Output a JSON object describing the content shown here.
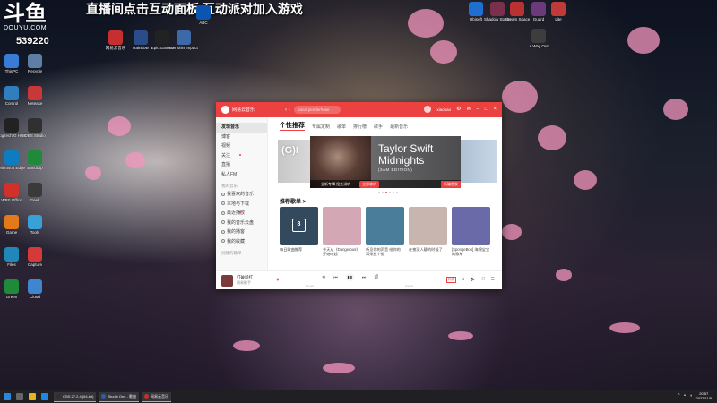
{
  "stream": {
    "logo_text": "斗鱼",
    "logo_sub": "DOUYU.COM",
    "room_number": "539220",
    "banner": "直播间点击互动面板 互动派对加入游戏"
  },
  "desktop_icons": {
    "top_row": [
      {
        "label": "网易云音乐",
        "color": "#c62f2f"
      },
      {
        "label": "Rainbow",
        "color": "#2a4d8a"
      },
      {
        "label": "Epic Games",
        "color": "#222222"
      },
      {
        "label": "Genshin Impact",
        "color": "#3c6aa8"
      },
      {
        "label": "ABC",
        "color": "#0a55b0"
      }
    ],
    "top_right": [
      {
        "label": "Ubisoft",
        "color": "#1f6fd1"
      },
      {
        "label": "Shadow Spirits",
        "color": "#7a2f4a"
      },
      {
        "label": "Stream Space",
        "color": "#b93131"
      },
      {
        "label": "Guard",
        "color": "#6b3a7a"
      },
      {
        "label": "Lite",
        "color": "#c03a3a"
      },
      {
        "label": "A Way Out",
        "color": "#3d3d3d"
      }
    ],
    "left_col": [
      {
        "label": "ThisPC",
        "color": "#3a7bd5"
      },
      {
        "label": "Recycle",
        "color": "#5e7ea6"
      },
      {
        "label": "Control",
        "color": "#2f7fbf"
      },
      {
        "label": "Netease",
        "color": "#c83838"
      },
      {
        "label": "Logitech G HUB",
        "color": "#222222"
      },
      {
        "label": "OBS Studio",
        "color": "#303030"
      },
      {
        "label": "Microsoft Edge",
        "color": "#0f7bc1"
      },
      {
        "label": "Bandizip",
        "color": "#1e8a3a"
      },
      {
        "label": "WPS Office",
        "color": "#d2302b"
      },
      {
        "label": "Geek",
        "color": "#3a3a3a"
      },
      {
        "label": "Game",
        "color": "#e37a1a"
      },
      {
        "label": "Tools",
        "color": "#3aa0d8"
      },
      {
        "label": "Files",
        "color": "#1f88b8"
      },
      {
        "label": "Capture",
        "color": "#d43a3a"
      },
      {
        "label": "Green",
        "color": "#1f8a3a"
      },
      {
        "label": "Cloud",
        "color": "#3f86d0"
      }
    ]
  },
  "window": {
    "app_name": "网易云音乐",
    "search_placeholder": "carol penderhose",
    "user_name": "xiaohao",
    "sidebar": [
      {
        "label": "发现音乐",
        "active": true
      },
      {
        "label": "博客"
      },
      {
        "label": "视频"
      },
      {
        "label": "关注",
        "dot": true
      },
      {
        "label": "直播"
      },
      {
        "label": "私人FM"
      }
    ],
    "sidebar_section": "我的音乐",
    "sidebar_mine": [
      {
        "label": "我喜欢的音乐"
      },
      {
        "label": "本地与下载"
      },
      {
        "label": "最近播放",
        "dot": true
      },
      {
        "label": "我的音乐云盘"
      },
      {
        "label": "我的播客"
      },
      {
        "label": "我的收藏"
      }
    ],
    "sidebar_section2": "创建的歌单",
    "tabs": [
      "个性推荐",
      "专属定制",
      "歌单",
      "排行榜",
      "歌手",
      "最新音乐"
    ],
    "banner": {
      "left_text": "(G)I",
      "title_line1": "Taylor Swift",
      "title_line2": "Midnights",
      "subtitle": "(3AM EDITION)",
      "foot_label": "全新专辑 抢先试听",
      "foot_button": "立即收听",
      "tag": "新碟首发"
    },
    "section_title": "推荐歌单 >",
    "cards": [
      {
        "caption": "每日歌曲推荐",
        "color": "#33495e"
      },
      {
        "caption": "今天从《Dangerous》开始听起",
        "color": "#d4a7b5"
      },
      {
        "caption": "听见你的声音 给你的耳朵放个假",
        "color": "#4a7d9a"
      },
      {
        "caption": "在夜深人静的时候了",
        "color": "#c9b5b0"
      },
      {
        "caption": "[SpongeBob] 海绵宝宝的歌单",
        "color": "#6a6aa8"
      }
    ],
    "player": {
      "song": "打破就打",
      "artist": "网易歌手",
      "time_now": "00:00",
      "time_total": "03:50",
      "quality": "标准",
      "progress_fraction": 0.0
    }
  },
  "taskbar": {
    "apps": [
      {
        "label": "OBS 27.2.4 (64-bit)",
        "color": "#303030"
      },
      {
        "label": "Studio One - 歌曲",
        "color": "#2f5fa0"
      },
      {
        "label": "网易云音乐",
        "color": "#c62f2f"
      }
    ],
    "time": "20:57",
    "date": "2022/11/8"
  }
}
